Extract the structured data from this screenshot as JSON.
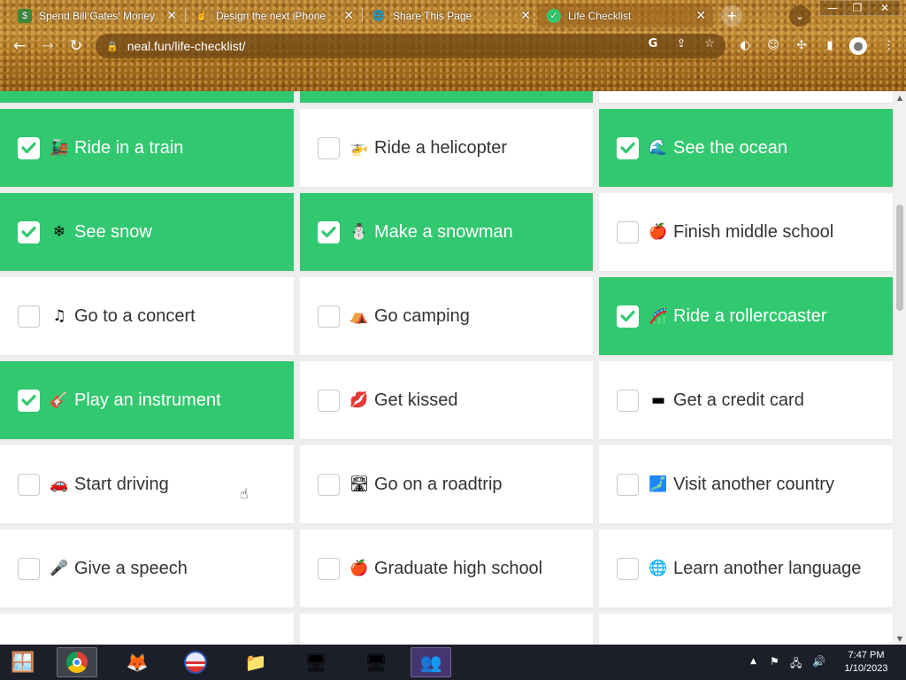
{
  "browser": {
    "tabs": [
      {
        "title": "Spend Bill Gates' Money",
        "favicon": "money-icon",
        "active": false
      },
      {
        "title": "Design the next iPhone",
        "favicon": "hand-icon",
        "active": false
      },
      {
        "title": "Share This Page",
        "favicon": "globe-icon",
        "active": false
      },
      {
        "title": "Life Checklist",
        "favicon": "check-icon",
        "active": true
      }
    ],
    "url": "neal.fun/life-checklist/"
  },
  "checklist": [
    {
      "label": "Ride in a train",
      "icon": "🚂",
      "checked": true
    },
    {
      "label": "Ride a helicopter",
      "icon": "🚁",
      "checked": false
    },
    {
      "label": "See the ocean",
      "icon": "🌊",
      "checked": true
    },
    {
      "label": "See snow",
      "icon": "❄",
      "checked": true
    },
    {
      "label": "Make a snowman",
      "icon": "⛄",
      "checked": true
    },
    {
      "label": "Finish middle school",
      "icon": "🍎",
      "checked": false
    },
    {
      "label": "Go to a concert",
      "icon": "♫",
      "checked": false
    },
    {
      "label": "Go camping",
      "icon": "⛺",
      "checked": false
    },
    {
      "label": "Ride a rollercoaster",
      "icon": "🎢",
      "checked": true
    },
    {
      "label": "Play an instrument",
      "icon": "🎸",
      "checked": true
    },
    {
      "label": "Get kissed",
      "icon": "💋",
      "checked": false
    },
    {
      "label": "Get a credit card",
      "icon": "▬",
      "checked": false
    },
    {
      "label": "Start driving",
      "icon": "🚗",
      "checked": false
    },
    {
      "label": "Go on a roadtrip",
      "icon": "🛣",
      "checked": false
    },
    {
      "label": "Visit another country",
      "icon": "🗾",
      "checked": false
    },
    {
      "label": "Give a speech",
      "icon": "🎤",
      "checked": false
    },
    {
      "label": "Graduate high school",
      "icon": "🍎",
      "checked": false
    },
    {
      "label": "Learn another language",
      "icon": "🌐",
      "checked": false
    }
  ],
  "taskbar": {
    "time": "7:47 PM",
    "date": "1/10/2023"
  },
  "colors": {
    "checked_green": "#31c870",
    "card_white": "#ffffff",
    "page_bg": "#eeeeee"
  }
}
